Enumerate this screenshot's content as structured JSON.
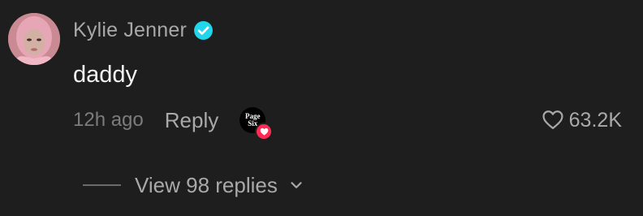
{
  "comment": {
    "author": "Kylie Jenner",
    "verified": true,
    "text": "daddy",
    "timestamp": "12h ago",
    "reply_label": "Reply",
    "creator_liked_by": {
      "avatar_text_line1": "Page",
      "avatar_text_line2": "Six"
    },
    "like_count": "63.2K",
    "view_replies_label": "View 98 replies"
  },
  "icons": {
    "verified": "verified-badge-icon",
    "heart": "heart-outline-icon",
    "chevron": "chevron-down-icon",
    "creator_heart": "heart-filled-icon"
  },
  "colors": {
    "background": "#1e1e1e",
    "verified": "#20d5ec",
    "creator_heart_badge": "#fe2c55",
    "muted_text": "#a9a9a9",
    "timestamp_text": "#7c7c7c"
  }
}
